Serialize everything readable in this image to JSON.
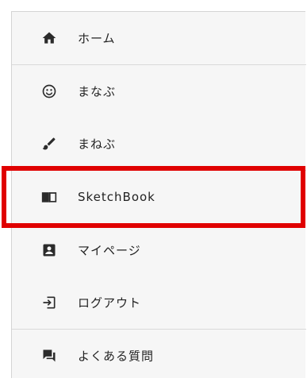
{
  "menu": {
    "items": [
      {
        "label": "ホーム",
        "icon": "home-icon"
      },
      {
        "label": "まなぶ",
        "icon": "smiley-icon"
      },
      {
        "label": "まねぶ",
        "icon": "brush-icon"
      },
      {
        "label": "SketchBook",
        "icon": "open-book-icon"
      },
      {
        "label": "マイページ",
        "icon": "account-box-icon"
      },
      {
        "label": "ログアウト",
        "icon": "logout-icon"
      },
      {
        "label": "よくある質問",
        "icon": "chat-bubbles-icon"
      }
    ],
    "highlighted_item": "SketchBook"
  },
  "colors": {
    "background": "#f6f6f6",
    "icon": "#2b2b2b",
    "text": "#222222",
    "highlight_border": "#e00000"
  }
}
